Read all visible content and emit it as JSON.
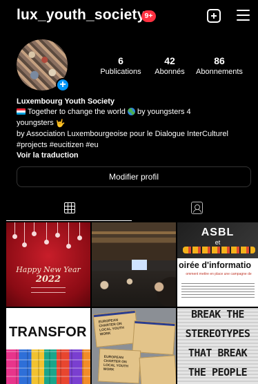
{
  "header": {
    "username": "lux_youth_society",
    "notification_badge": "9+",
    "icons": [
      "create-post-icon",
      "menu-icon"
    ]
  },
  "stats": [
    {
      "value": "6",
      "label": "Publications"
    },
    {
      "value": "42",
      "label": "Abonnés"
    },
    {
      "value": "86",
      "label": "Abonnements"
    }
  ],
  "bio": {
    "name": "Luxembourg Youth Society",
    "line1_a": "Together to change the world",
    "line1_b": "by youngsters  4",
    "line2": "youngsters",
    "line3": "by Association Luxembourgeoise pour le Dialogue InterCulturel",
    "hashtags": "#projects #eucitizen #eu",
    "translate": "Voir la traduction"
  },
  "actions": {
    "edit_profile": "Modifier profil"
  },
  "tabs": [
    {
      "name": "posts",
      "icon": "grid-icon",
      "active": true
    },
    {
      "name": "tagged",
      "icon": "tagged-icon",
      "active": false
    }
  ],
  "posts": {
    "p1": {
      "title": "Happy New Year",
      "year": "2022"
    },
    "p3": {
      "top": "ASBL",
      "et": "et",
      "title": "oirée d'informatio",
      "sub": "omment mettre en place une campagne de"
    },
    "p4": {
      "title": "TRANSFOR"
    },
    "p5": {
      "env1": "EUROPEAN CHARTER ON LOCAL YOUTH WORK",
      "env2": "EUROPEAN CHARTER ON LOCAL YOUTH WORK"
    },
    "p6": {
      "line1": "BREAK THE",
      "line2": "STEREOTYPES",
      "line3": "THAT BREAK",
      "line4": "THE PEOPLE"
    }
  },
  "colors": {
    "background": "#000000",
    "badge": "#ff3040",
    "avatar_add": "#0095f6"
  }
}
